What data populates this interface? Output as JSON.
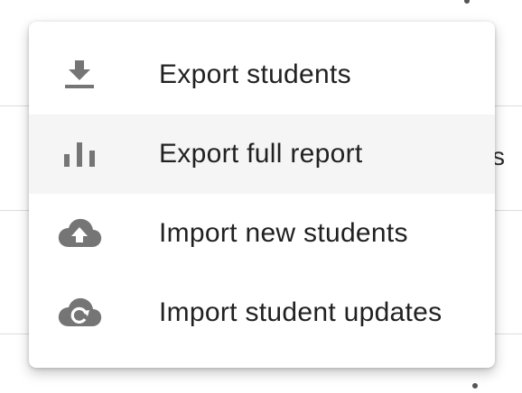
{
  "menu": {
    "items": [
      {
        "label": "Export students",
        "icon": "download-icon",
        "highlighted": false
      },
      {
        "label": "Export full report",
        "icon": "bar-chart-icon",
        "highlighted": true
      },
      {
        "label": "Import new students",
        "icon": "cloud-upload-icon",
        "highlighted": false
      },
      {
        "label": "Import student updates",
        "icon": "cloud-sync-icon",
        "highlighted": false
      }
    ]
  },
  "colors": {
    "icon": "#757575",
    "text": "#212121",
    "highlight": "#f5f5f5"
  }
}
